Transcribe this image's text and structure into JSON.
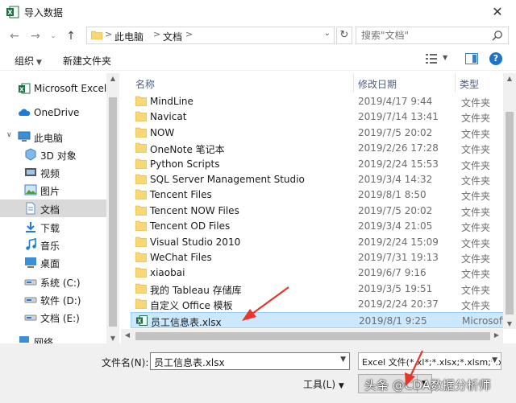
{
  "window": {
    "title": "导入数据",
    "close": "✕"
  },
  "address": {
    "crumbs": [
      "此电脑",
      "文档"
    ]
  },
  "search": {
    "placeholder": "搜索\"文档\""
  },
  "toolbar": {
    "organize": "组织",
    "new_folder": "新建文件夹"
  },
  "nav": {
    "items": [
      {
        "label": "Microsoft Excel",
        "icon": "excel-icon"
      },
      {
        "label": "OneDrive",
        "icon": "cloud-icon"
      },
      {
        "label": "此电脑",
        "icon": "computer-icon"
      },
      {
        "label": "3D 对象",
        "icon": "3d-objects-icon"
      },
      {
        "label": "视频",
        "icon": "video-icon"
      },
      {
        "label": "图片",
        "icon": "pictures-icon"
      },
      {
        "label": "文档",
        "icon": "documents-icon"
      },
      {
        "label": "下载",
        "icon": "download-icon"
      },
      {
        "label": "音乐",
        "icon": "music-icon"
      },
      {
        "label": "桌面",
        "icon": "desktop-icon"
      },
      {
        "label": "系统 (C:)",
        "icon": "drive-icon"
      },
      {
        "label": "软件 (D:)",
        "icon": "drive-icon"
      },
      {
        "label": "文档 (E:)",
        "icon": "drive-icon"
      },
      {
        "label": "网络",
        "icon": "network-icon"
      }
    ],
    "selected_index": 6
  },
  "columns": {
    "name": "名称",
    "modified": "修改日期",
    "type": "类型"
  },
  "files": [
    {
      "name": "MindLine",
      "date": "2019/4/17 9:44",
      "type": "文件夹"
    },
    {
      "name": "Navicat",
      "date": "2019/7/14 13:41",
      "type": "文件夹"
    },
    {
      "name": "NOW",
      "date": "2019/7/5 20:02",
      "type": "文件夹"
    },
    {
      "name": "OneNote 笔记本",
      "date": "2019/2/26 17:28",
      "type": "文件夹"
    },
    {
      "name": "Python Scripts",
      "date": "2019/2/24 15:53",
      "type": "文件夹"
    },
    {
      "name": "SQL Server Management Studio",
      "date": "2019/3/4 14:32",
      "type": "文件夹"
    },
    {
      "name": "Tencent Files",
      "date": "2019/8/1 8:50",
      "type": "文件夹"
    },
    {
      "name": "Tencent NOW Files",
      "date": "2019/7/5 20:02",
      "type": "文件夹"
    },
    {
      "name": "Tencent OD Files",
      "date": "2019/3/4 21:05",
      "type": "文件夹"
    },
    {
      "name": "Visual Studio 2010",
      "date": "2019/2/24 15:09",
      "type": "文件夹"
    },
    {
      "name": "WeChat Files",
      "date": "2019/7/31 19:13",
      "type": "文件夹"
    },
    {
      "name": "xiaobai",
      "date": "2019/6/7 9:16",
      "type": "文件夹"
    },
    {
      "name": "我的 Tableau 存储库",
      "date": "2019/3/5 19:51",
      "type": "文件夹"
    },
    {
      "name": "自定义 Office 模板",
      "date": "2019/2/24 20:37",
      "type": "文件夹"
    },
    {
      "name": "员工信息表.xlsx",
      "date": "2019/8/1 9:25",
      "type": "Microsoft",
      "is_excel": true,
      "selected": true
    }
  ],
  "footer": {
    "filename_label": "文件名(N):",
    "filename_value": "员工信息表.xlsx",
    "filetype_value": "Excel 文件(*.xl*;*.xlsx;*.xlsm;*.x",
    "tools_label": "工具(L)",
    "tools_caret": "▼",
    "watermark": "头条 @CDA数据分析师"
  },
  "colors": {
    "selection": "#cce8ff",
    "folder": "#f8d775",
    "excel": "#1d6f42",
    "annotation": "#e8362c"
  }
}
